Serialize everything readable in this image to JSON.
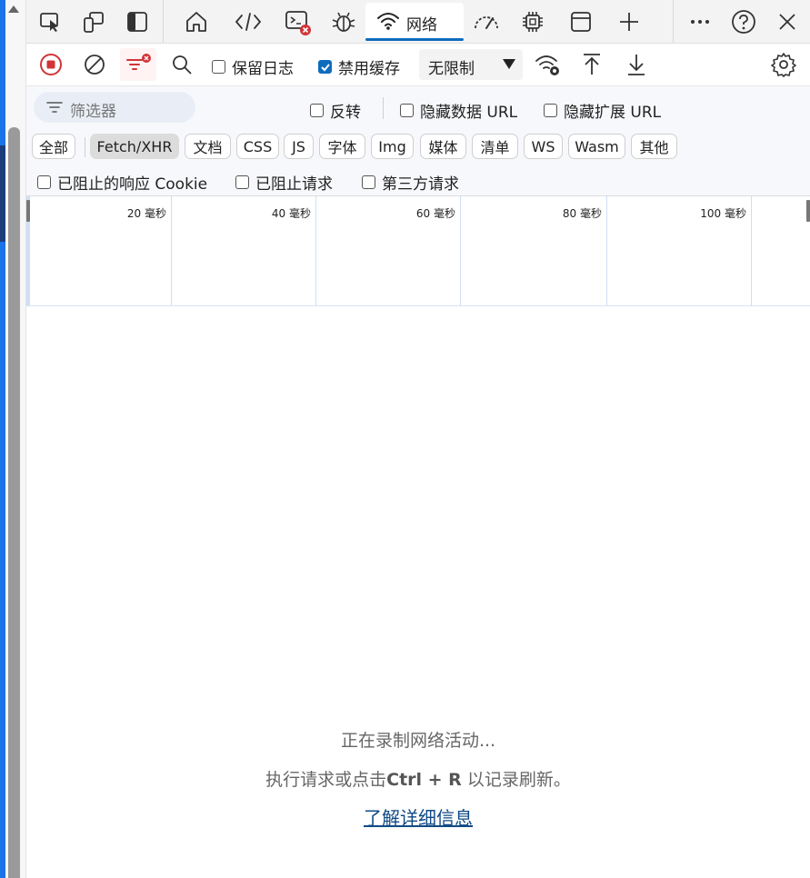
{
  "tabs": {
    "network_label": "网络",
    "icons": [
      "inspect-icon",
      "device-emulation-icon",
      "sidebar-icon",
      "welcome-home-icon",
      "elements-code-icon",
      "console-icon",
      "sources-bug-icon",
      "network-wifi-icon",
      "performance-gauge-icon",
      "memory-chip-icon",
      "application-window-icon",
      "add-tab-icon",
      "more-icon",
      "help-icon",
      "close-icon"
    ],
    "console_error_color": "#d13438",
    "active_underline_color": "#0f6cbd"
  },
  "toolbar": {
    "preserve_log_label": "保留日志",
    "preserve_log_checked": false,
    "disable_cache_label": "禁用缓存",
    "disable_cache_checked": true,
    "throttling_value": "无限制",
    "record_color": "#d13438"
  },
  "filter": {
    "placeholder": "筛选器",
    "invert_label": "反转",
    "hide_data_urls_label": "隐藏数据 URL",
    "hide_extension_urls_label": "隐藏扩展 URL"
  },
  "types": [
    {
      "label": "全部",
      "active": false
    },
    {
      "label": "Fetch/XHR",
      "active": true
    },
    {
      "label": "文档",
      "active": false
    },
    {
      "label": "CSS",
      "active": false
    },
    {
      "label": "JS",
      "active": false
    },
    {
      "label": "字体",
      "active": false
    },
    {
      "label": "Img",
      "active": false
    },
    {
      "label": "媒体",
      "active": false
    },
    {
      "label": "清单",
      "active": false
    },
    {
      "label": "WS",
      "active": false
    },
    {
      "label": "Wasm",
      "active": false
    },
    {
      "label": "其他",
      "active": false
    }
  ],
  "blocked": {
    "blocked_cookies_label": "已阻止的响应 Cookie",
    "blocked_requests_label": "已阻止请求",
    "third_party_label": "第三方请求"
  },
  "timeline": {
    "ticks": [
      "20 毫秒",
      "40 毫秒",
      "60 毫秒",
      "80 毫秒",
      "100 毫秒"
    ]
  },
  "empty_state": {
    "line1": "正在录制网络活动...",
    "line2_prefix": "执行请求或点击",
    "line2_key": "Ctrl + R",
    "line2_suffix": " 以记录刷新。",
    "link": "了解详细信息"
  }
}
